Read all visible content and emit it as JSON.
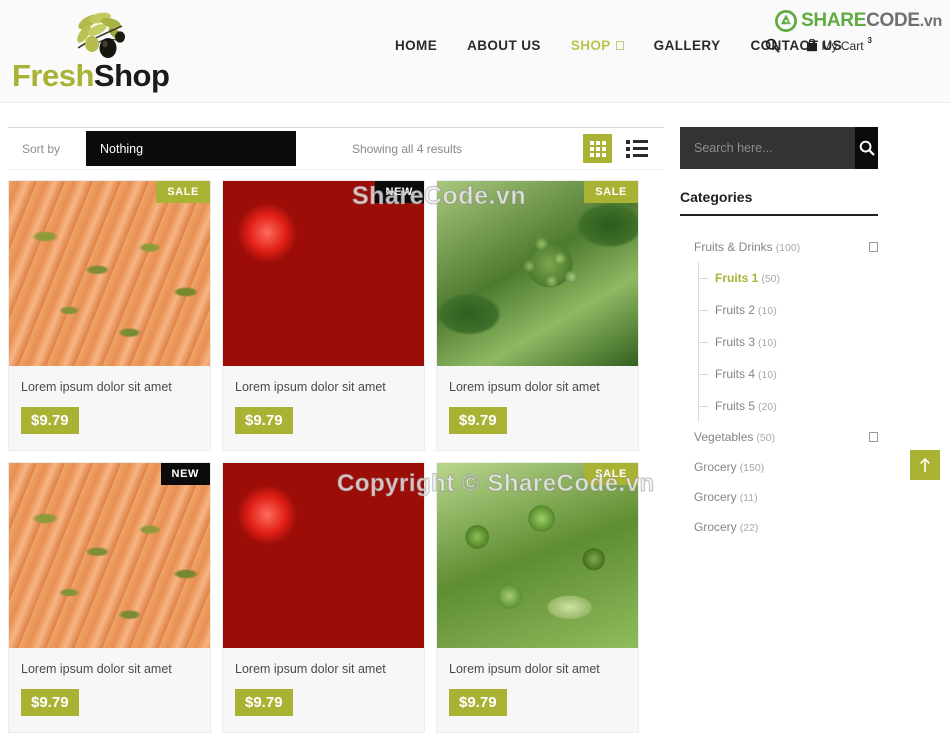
{
  "header": {
    "logo": {
      "part1": "Fresh",
      "part2": "Shop",
      "icon": "olive-branch-icon"
    },
    "nav": [
      {
        "label": "HOME",
        "active": false
      },
      {
        "label": "ABOUT US",
        "active": false
      },
      {
        "label": "SHOP",
        "active": true
      },
      {
        "label": "GALLERY",
        "active": false
      },
      {
        "label": "CONTACT US",
        "active": false
      }
    ],
    "search_icon": "search-icon",
    "cart": {
      "label": "My Cart",
      "count": "3",
      "icon": "shopping-bag-icon"
    },
    "watermark_logo": {
      "part1": "SHARE",
      "part2": "CODE",
      "part3": ".vn"
    }
  },
  "toolbar": {
    "sort_label": "Sort by",
    "sort_value": "Nothing",
    "results": "Showing all 4 results",
    "grid_view": "grid-view-icon",
    "list_view": "list-view-icon"
  },
  "products": [
    {
      "title": "Lorem ipsum dolor sit amet",
      "price": "$9.79",
      "badge": "SALE",
      "badge_type": "sale",
      "image": "carrots-photo"
    },
    {
      "title": "Lorem ipsum dolor sit amet",
      "price": "$9.79",
      "badge": "NEW",
      "badge_type": "new",
      "image": "tomatoes-photo"
    },
    {
      "title": "Lorem ipsum dolor sit amet",
      "price": "$9.79",
      "badge": "SALE",
      "badge_type": "sale",
      "image": "grapes-photo"
    }
  ],
  "products_row2": [
    {
      "badge": "NEW",
      "badge_type": "new",
      "image": "carrots-photo"
    },
    {
      "badge": "",
      "badge_type": "none",
      "image": "tomatoes-photo"
    },
    {
      "badge": "SALE",
      "badge_type": "sale",
      "image": "vegetables-photo"
    }
  ],
  "sidebar": {
    "search_placeholder": "Search here...",
    "search_value": "",
    "categories_heading": "Categories",
    "categories": [
      {
        "name": "Fruits & Drinks",
        "count": "(100)",
        "has_toggle": true,
        "subcategories": [
          {
            "name": "Fruits 1",
            "count": "(50)",
            "active": true
          },
          {
            "name": "Fruits 2",
            "count": "(10)",
            "active": false
          },
          {
            "name": "Fruits 3",
            "count": "(10)",
            "active": false
          },
          {
            "name": "Fruits 4",
            "count": "(10)",
            "active": false
          },
          {
            "name": "Fruits 5",
            "count": "(20)",
            "active": false
          }
        ]
      },
      {
        "name": "Vegetables",
        "count": "(50)",
        "has_toggle": true,
        "subcategories": []
      },
      {
        "name": "Grocery",
        "count": "(150)",
        "has_toggle": false,
        "subcategories": []
      },
      {
        "name": "Grocery",
        "count": "(11)",
        "has_toggle": false,
        "subcategories": []
      },
      {
        "name": "Grocery",
        "count": "(22)",
        "has_toggle": false,
        "subcategories": []
      }
    ]
  },
  "watermarks": {
    "middle": "ShareCode.vn",
    "bottom": "Copyright © ShareCode.vn"
  },
  "scroll_top": "scroll-to-top-icon",
  "colors": {
    "accent": "#a9b233",
    "dark": "#0b0b0b",
    "search_bg": "#333333"
  }
}
